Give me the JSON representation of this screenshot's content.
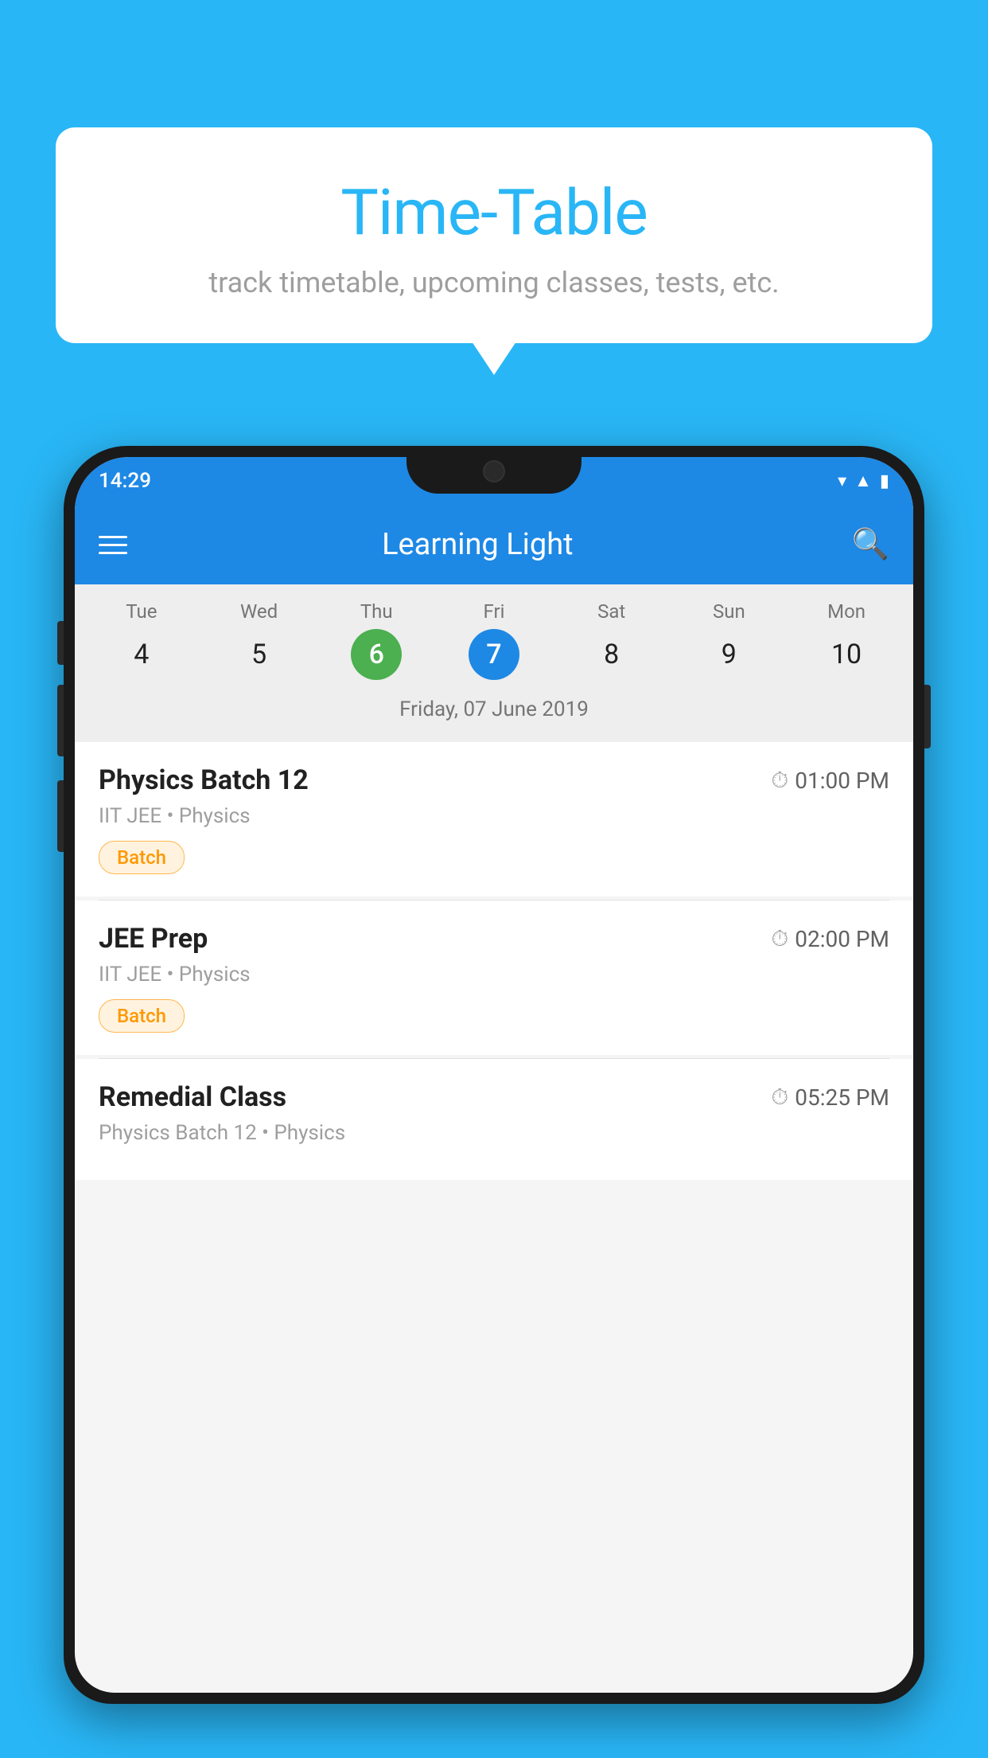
{
  "background_color": "#29B6F6",
  "bubble": {
    "title": "Time-Table",
    "subtitle": "track timetable, upcoming classes, tests, etc."
  },
  "phone": {
    "status_bar": {
      "time": "14:29",
      "icons": [
        "wifi",
        "signal",
        "battery"
      ]
    },
    "app_bar": {
      "title": "Learning Light"
    },
    "calendar": {
      "days": [
        {
          "name": "Tue",
          "num": "4",
          "state": "normal"
        },
        {
          "name": "Wed",
          "num": "5",
          "state": "normal"
        },
        {
          "name": "Thu",
          "num": "6",
          "state": "today"
        },
        {
          "name": "Fri",
          "num": "7",
          "state": "selected"
        },
        {
          "name": "Sat",
          "num": "8",
          "state": "normal"
        },
        {
          "name": "Sun",
          "num": "9",
          "state": "normal"
        },
        {
          "name": "Mon",
          "num": "10",
          "state": "normal"
        }
      ],
      "selected_label": "Friday, 07 June 2019"
    },
    "schedule": [
      {
        "title": "Physics Batch 12",
        "time": "01:00 PM",
        "subtitle": "IIT JEE • Physics",
        "badge": "Batch"
      },
      {
        "title": "JEE Prep",
        "time": "02:00 PM",
        "subtitle": "IIT JEE • Physics",
        "badge": "Batch"
      },
      {
        "title": "Remedial Class",
        "time": "05:25 PM",
        "subtitle": "Physics Batch 12 • Physics",
        "badge": null
      }
    ]
  }
}
